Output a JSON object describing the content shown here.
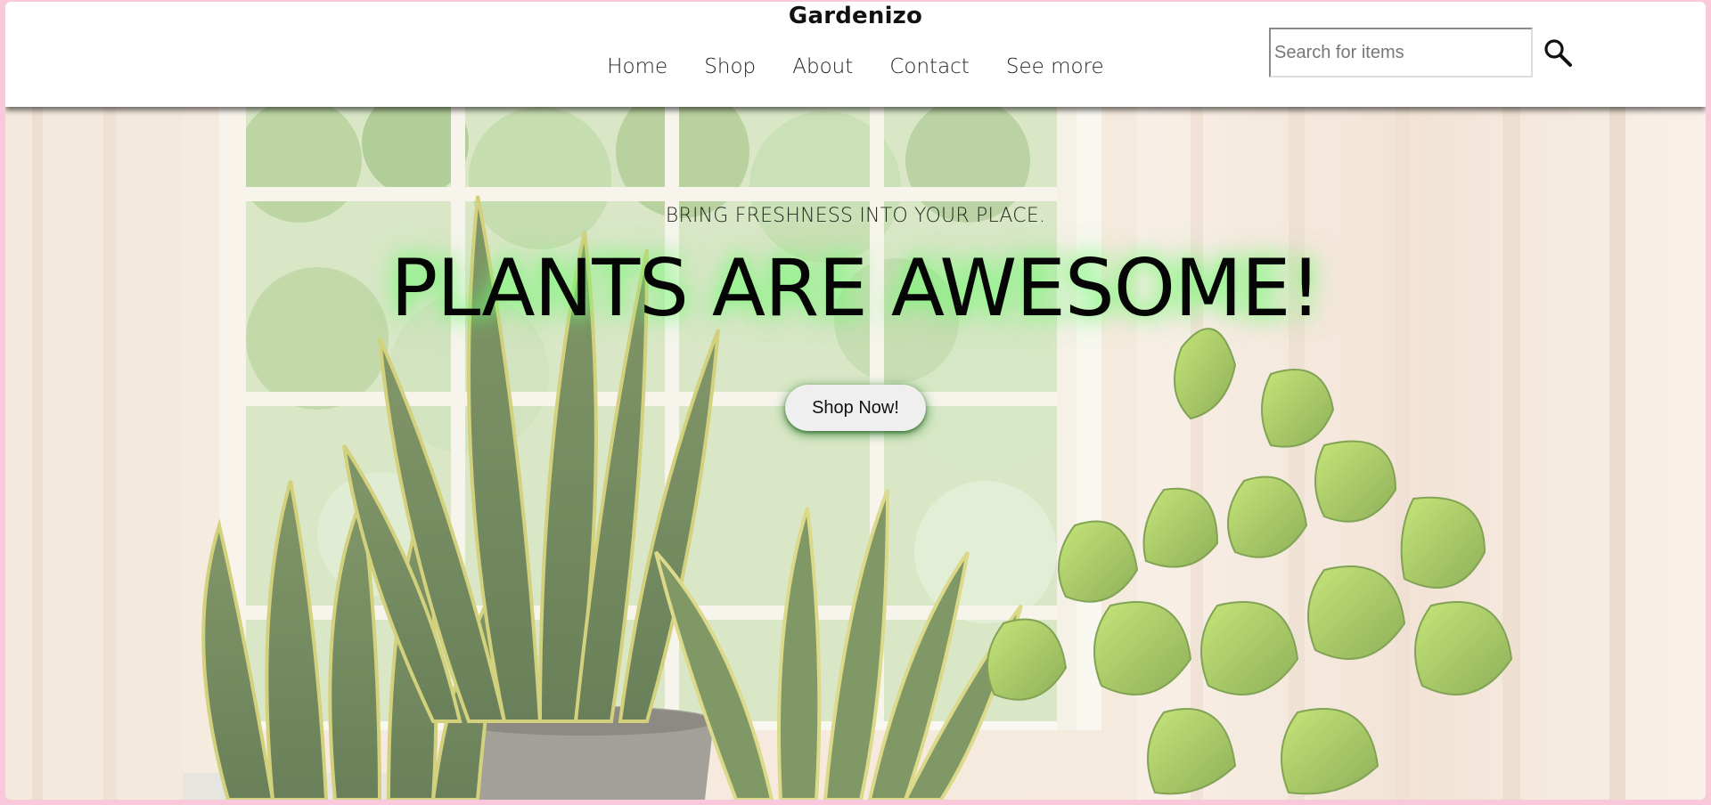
{
  "header": {
    "brand": "Gardenizo",
    "nav": [
      {
        "label": "Home"
      },
      {
        "label": "Shop"
      },
      {
        "label": "About"
      },
      {
        "label": "Contact"
      },
      {
        "label": "See more"
      }
    ],
    "search": {
      "placeholder": "Search for items",
      "value": "",
      "icon": "search-icon"
    }
  },
  "hero": {
    "tagline": "BRING FRESHNESS INTO YOUR PLACE.",
    "headline": "PLANTS ARE AWESOME!",
    "cta_label": "Shop Now!",
    "background": "plants-by-window-image"
  },
  "colors": {
    "page_border": "#f9c8da",
    "header_bg": "#ffffff",
    "headline_glow": "#6eff6e",
    "button_bg": "#efefef"
  }
}
